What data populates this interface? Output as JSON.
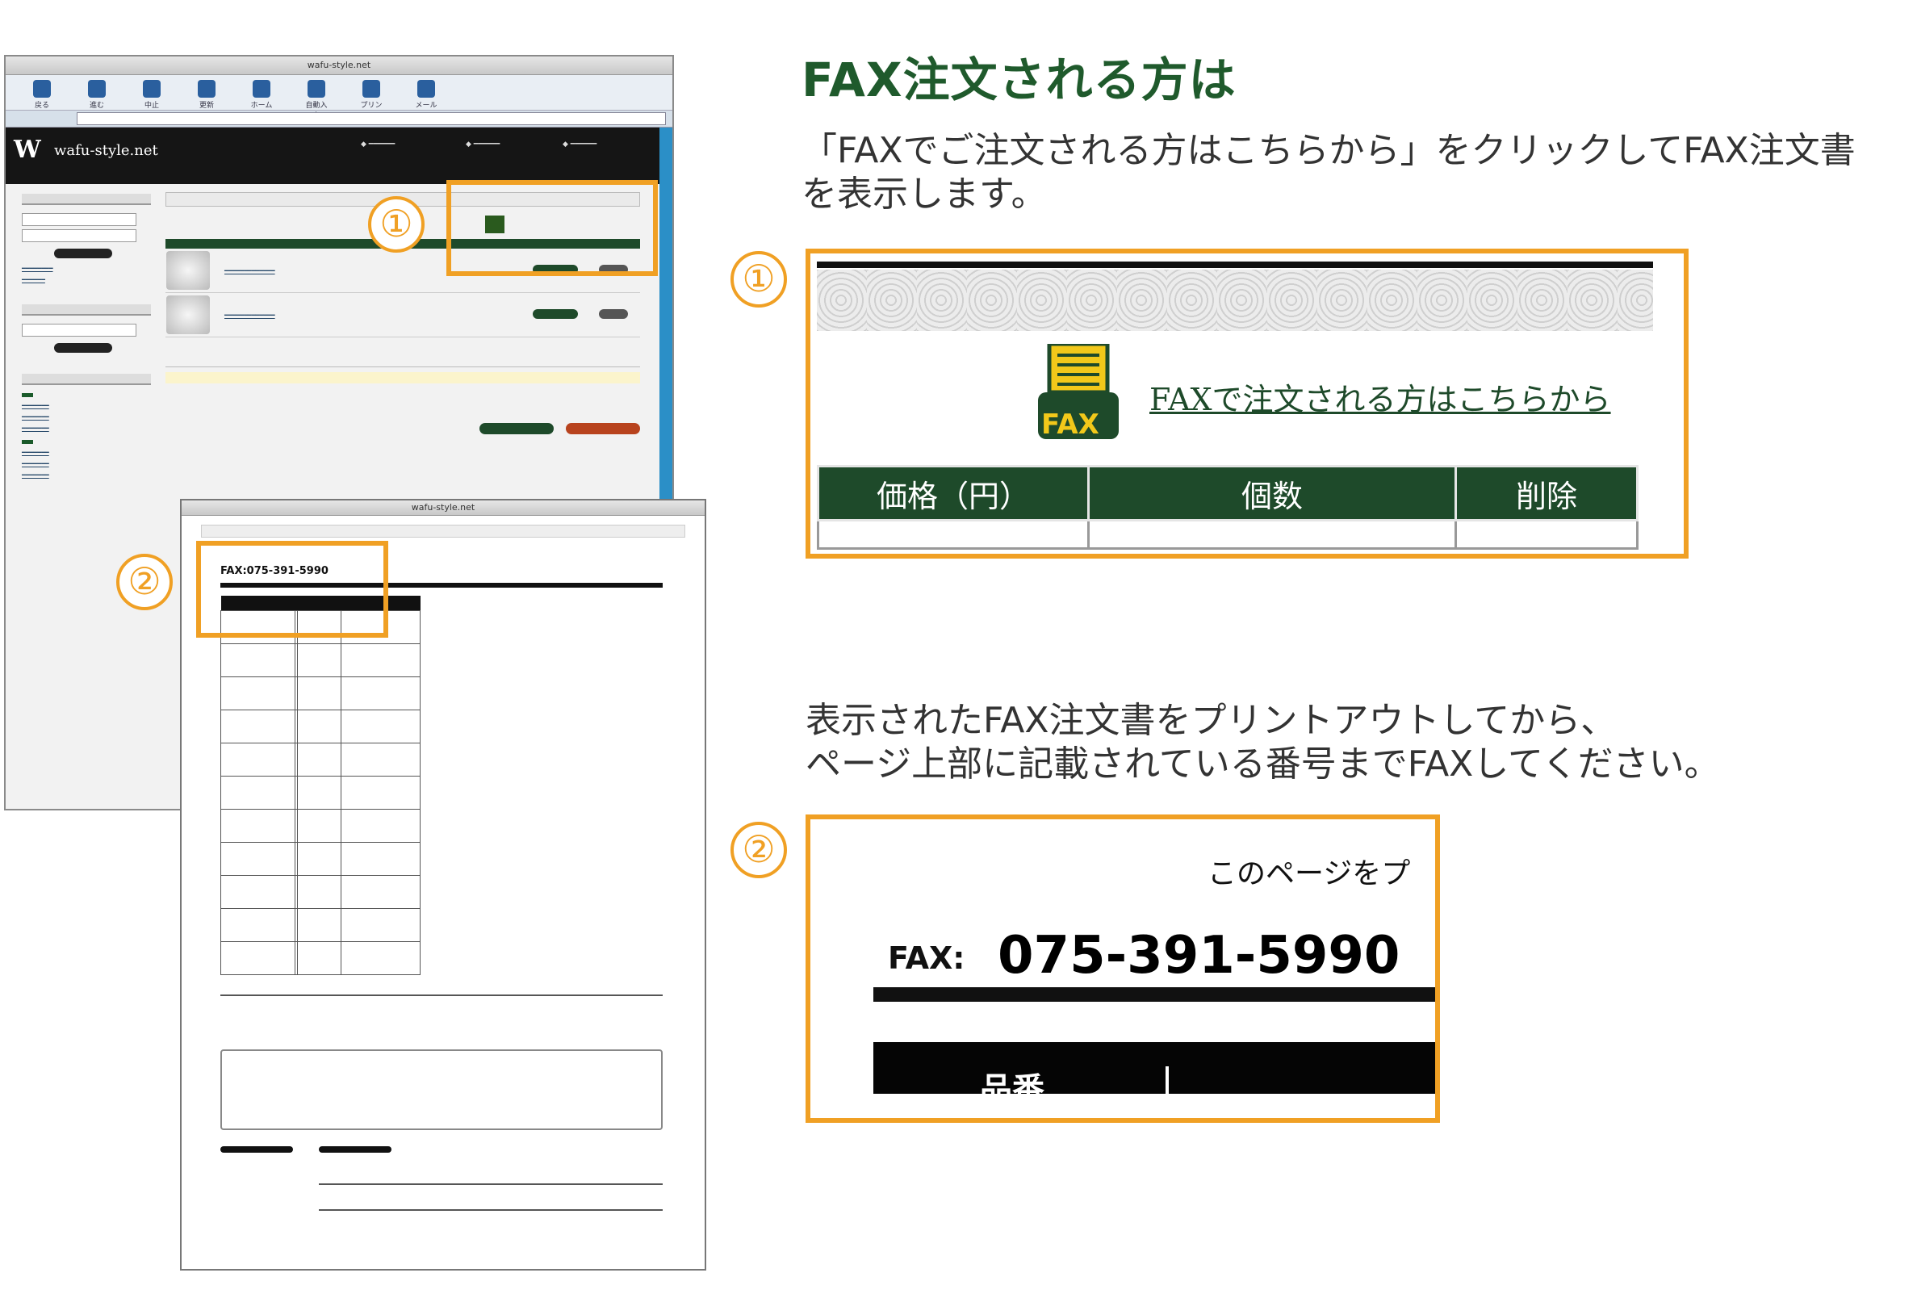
{
  "heading": "FAX注文される方は",
  "instruction1": {
    "line1": "「FAXでご注文される方はこちらから」をクリックしてFAX注文書",
    "line2": "を表示します。"
  },
  "instruction2": {
    "line1": "表示されたFAX注文書をプリントアウトしてから、",
    "line2": "ページ上部に記載されている番号までFAXしてください。"
  },
  "markers": {
    "one": "①",
    "two": "②"
  },
  "zoom1": {
    "fax_icon_label": "FAX",
    "fax_link": "FAXで注文される方はこちらから",
    "columns": [
      "価格（円）",
      "個数",
      "削除"
    ]
  },
  "zoom2": {
    "top_text": "このページをプ",
    "fax_label": "FAX:",
    "fax_number": "075-391-5990",
    "column": "品番"
  },
  "browser": {
    "title": "wafu-style.net",
    "site_name": "wafu-style.net",
    "toolbar": [
      "戻る",
      "進む",
      "中止",
      "更新",
      "ホーム",
      "自動入力",
      "プリント",
      "メール"
    ]
  },
  "fax_window": {
    "title": "wafu-style.net",
    "fax_small": "FAX:075-391-5990"
  },
  "colors": {
    "accent_orange": "#f0a024",
    "heading_green": "#1f5a2c",
    "table_green": "#1e4a2a"
  }
}
